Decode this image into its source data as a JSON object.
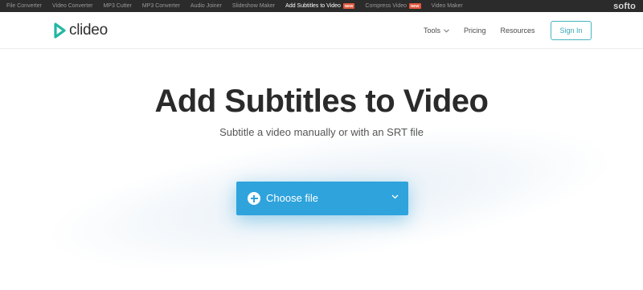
{
  "topbar": {
    "items": [
      {
        "label": "File Converter"
      },
      {
        "label": "Video Converter"
      },
      {
        "label": "MP3 Cutter"
      },
      {
        "label": "MP3 Converter"
      },
      {
        "label": "Audio Joiner"
      },
      {
        "label": "Slideshow Maker"
      },
      {
        "label": "Add Subtitles to Video",
        "badge": "NEW",
        "active": true
      },
      {
        "label": "Compress Video",
        "badge": "NEW"
      },
      {
        "label": "Video Maker"
      }
    ],
    "brand": "softo"
  },
  "header": {
    "logo_text": "clideo",
    "nav": {
      "tools": "Tools",
      "pricing": "Pricing",
      "resources": "Resources"
    },
    "signin": "Sign In"
  },
  "hero": {
    "title": "Add Subtitles to Video",
    "subtitle": "Subtitle a video manually or with an SRT file",
    "choose_file": "Choose file"
  },
  "colors": {
    "accent": "#2fa3dc",
    "logo_teal": "#23b6a3",
    "signin_border": "#46b4c0",
    "topbar_bg": "#2b2b2b",
    "badge": "#e2563c"
  }
}
